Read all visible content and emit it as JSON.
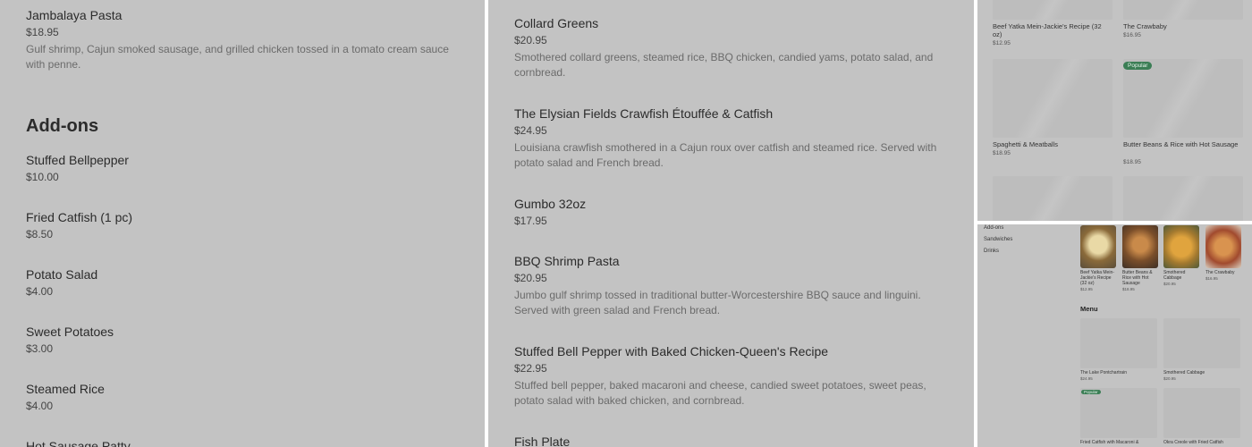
{
  "panel1": {
    "items": [
      {
        "name": "Jambalaya Pasta",
        "price": "$18.95",
        "desc": "Gulf shrimp, Cajun smoked sausage, and grilled chicken tossed in a tomato cream sauce with penne."
      }
    ],
    "addons_title": "Add-ons",
    "addons": [
      {
        "name": "Stuffed Bellpepper",
        "price": "$10.00"
      },
      {
        "name": "Fried Catfish (1 pc)",
        "price": "$8.50"
      },
      {
        "name": "Potato Salad",
        "price": "$4.00"
      },
      {
        "name": "Sweet Potatoes",
        "price": "$3.00"
      },
      {
        "name": "Steamed Rice",
        "price": "$4.00"
      },
      {
        "name": "Hot Sausage Patty",
        "price": ""
      }
    ]
  },
  "panel2": {
    "items": [
      {
        "name": "Collard Greens",
        "price": "$20.95",
        "desc": "Smothered collard greens, steamed rice, BBQ chicken, candied yams, potato salad, and cornbread."
      },
      {
        "name": "The Elysian Fields Crawfish Étouffée & Catfish",
        "price": "$24.95",
        "desc": "Louisiana crawfish smothered in a Cajun roux over catfish and steamed rice. Served with potato salad and French bread."
      },
      {
        "name": "Gumbo 32oz",
        "price": "$17.95",
        "desc": ""
      },
      {
        "name": "BBQ Shrimp Pasta",
        "price": "$20.95",
        "desc": "Jumbo gulf shrimp tossed in traditional butter-Worcestershire BBQ sauce and linguini. Served with green salad and French bread."
      },
      {
        "name": "Stuffed Bell Pepper with Baked Chicken-Queen's Recipe",
        "price": "$22.95",
        "desc": "Stuffed bell pepper, baked macaroni and cheese, candied sweet potatoes, sweet peas, potato salad with baked chicken, and cornbread."
      },
      {
        "name": "Fish Plate",
        "price": "",
        "desc": ""
      }
    ]
  },
  "panel3": {
    "badge": "Popular",
    "items": [
      {
        "name": "Beef Yatka Mein-Jackie's Recipe (32 oz)",
        "price": "$12.95"
      },
      {
        "name": "The Crawbaby",
        "price": "$16.95"
      },
      {
        "name": "Spaghetti & Meatballs",
        "price": "$18.95"
      },
      {
        "name": "Butter Beans & Rice with Hot Sausage",
        "price": "$18.95"
      }
    ]
  },
  "panel4": {
    "sidebar": [
      "Add-ons",
      "Sandwiches",
      "Drinks"
    ],
    "featured": [
      {
        "name": "Beef Yatka Mein-Jackie's Recipe (32 oz)",
        "price": "$12.95"
      },
      {
        "name": "Butter Beans & Rice with Hot Sausage",
        "price": "$18.95"
      },
      {
        "name": "Smothered Cabbage",
        "price": "$20.95"
      },
      {
        "name": "The Crawbaby",
        "price": "$16.95"
      }
    ],
    "menu_title": "Menu",
    "badge": "Popular",
    "menu": [
      {
        "name": "The Lake Pontchartrain",
        "price": "$24.95"
      },
      {
        "name": "Smothered Cabbage",
        "price": "$20.95"
      },
      {
        "name": "Fried Catfish with Macaroni &",
        "price": ""
      },
      {
        "name": "Okra Creole with Fried Catfish",
        "price": ""
      }
    ]
  }
}
